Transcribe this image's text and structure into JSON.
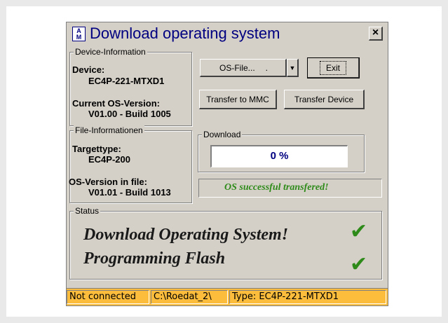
{
  "window": {
    "title": "Download operating system",
    "icon_text": "A\nM",
    "close_label": "×"
  },
  "device_info": {
    "legend": "Device-Information",
    "device_label": "Device:",
    "device_value": "EC4P-221-MTXD1",
    "os_version_label": "Current OS-Version:",
    "os_version_value": "V01.00 - Build 1005"
  },
  "buttons": {
    "os_file": "OS-File...",
    "exit": "Exit",
    "transfer_mmc": "Transfer to MMC",
    "transfer_device": "Transfer Device"
  },
  "file_info": {
    "legend": "File-Informationen",
    "targettype_label": "Targettype:",
    "targettype_value": "EC4P-200",
    "os_in_file_label": "OS-Version in file:",
    "os_in_file_value": "V01.01 - Build 1013"
  },
  "download": {
    "legend": "Download",
    "progress_text": "0 %",
    "message": "OS successful transfered!"
  },
  "status": {
    "legend": "Status",
    "lines": [
      {
        "text": "Download Operating System!",
        "done": true
      },
      {
        "text": "Programming Flash",
        "done": true
      }
    ],
    "check_color": "#2e8b1a"
  },
  "statusbar": {
    "connection": "Not connected",
    "path": "C:\\Roedat_2\\",
    "type": "Type: EC4P-221-MTXD1",
    "bg_color": "#fbbd3b"
  }
}
